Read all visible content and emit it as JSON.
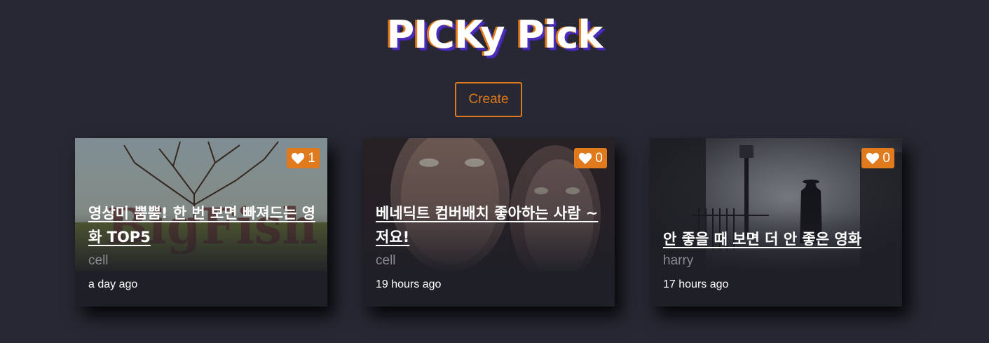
{
  "header": {
    "title": "PICKy Pick"
  },
  "actions": {
    "create_label": "Create"
  },
  "colors": {
    "background": "#272833",
    "accent": "#e07a1c",
    "card_bg": "#1f1f27",
    "title_shadow": "#4b2db8"
  },
  "cards": [
    {
      "title": "영상미 뿜뿜! 한 번 보면 빠져드는 영화 TOP5",
      "author": "cell",
      "time": "a day ago",
      "likes": "1",
      "like_icon": "heart-icon"
    },
    {
      "title": "베네딕트 컴버배치 좋아하는 사람 ~ 저요!",
      "author": "cell",
      "time": "19 hours ago",
      "likes": "0",
      "like_icon": "heart-icon"
    },
    {
      "title": "안 좋을 때 보면 더 안 좋은 영화",
      "author": "harry",
      "time": "17 hours ago",
      "likes": "0",
      "like_icon": "heart-icon"
    }
  ]
}
